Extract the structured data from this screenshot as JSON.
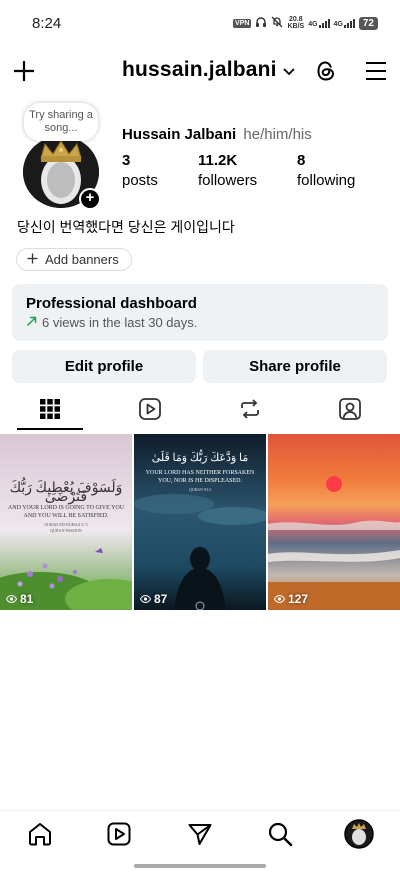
{
  "status_bar": {
    "time": "8:24",
    "vpn": "VPN",
    "speed_value": "20.8",
    "speed_unit": "KB/S",
    "net_1": "4G",
    "net_2": "4G",
    "battery": "72",
    "icons": [
      "vpn-icon",
      "headphones-icon",
      "mute-icon",
      "signal-icon",
      "signal-icon",
      "battery-icon"
    ]
  },
  "header": {
    "username": "hussain.jalbani",
    "icons": [
      "plus-icon",
      "chevron-down-icon",
      "threads-icon",
      "menu-icon"
    ]
  },
  "profile": {
    "note_bubble": "Try sharing a song...",
    "full_name": "Hussain Jalbani",
    "pronouns": "he/him/his",
    "stats": [
      {
        "value": "3",
        "label": "posts"
      },
      {
        "value": "11.2K",
        "label": "followers"
      },
      {
        "value": "8",
        "label": "following"
      }
    ],
    "bio": "당신이 번역했다면 당신은 게이입니다",
    "add_banners": "Add banners"
  },
  "dashboard": {
    "title": "Professional dashboard",
    "subtitle": "6 views in the last 30 days."
  },
  "actions": {
    "edit": "Edit profile",
    "share": "Share profile"
  },
  "tabs": [
    "grid-icon",
    "reels-icon",
    "reposts-icon",
    "tagged-icon"
  ],
  "posts": [
    {
      "count": "81",
      "arabic": "وَلَسَوْفَ يُعْطِيكَ رَبُّكَ فَتَرْضَىٰ",
      "text": "AND YOUR LORD IS GOING TO GIVE YOU AND YOU WILL BE SATISFIED.",
      "ref": "SURAH AD-DUHAA V. 5",
      "ref2": "QURAN PASSION"
    },
    {
      "count": "87",
      "arabic": "مَا وَدَّعَكَ رَبُّكَ وَمَا قَلَىٰ",
      "text": "YOUR LORD HAS NEITHER FORSAKEN YOU, NOR IS HE DISPLEASED.",
      "ref": "QURAN 93:3"
    },
    {
      "count": "127"
    }
  ],
  "bottom_nav": [
    "home-icon",
    "reels-icon",
    "send-icon",
    "search-icon",
    "profile-avatar"
  ]
}
